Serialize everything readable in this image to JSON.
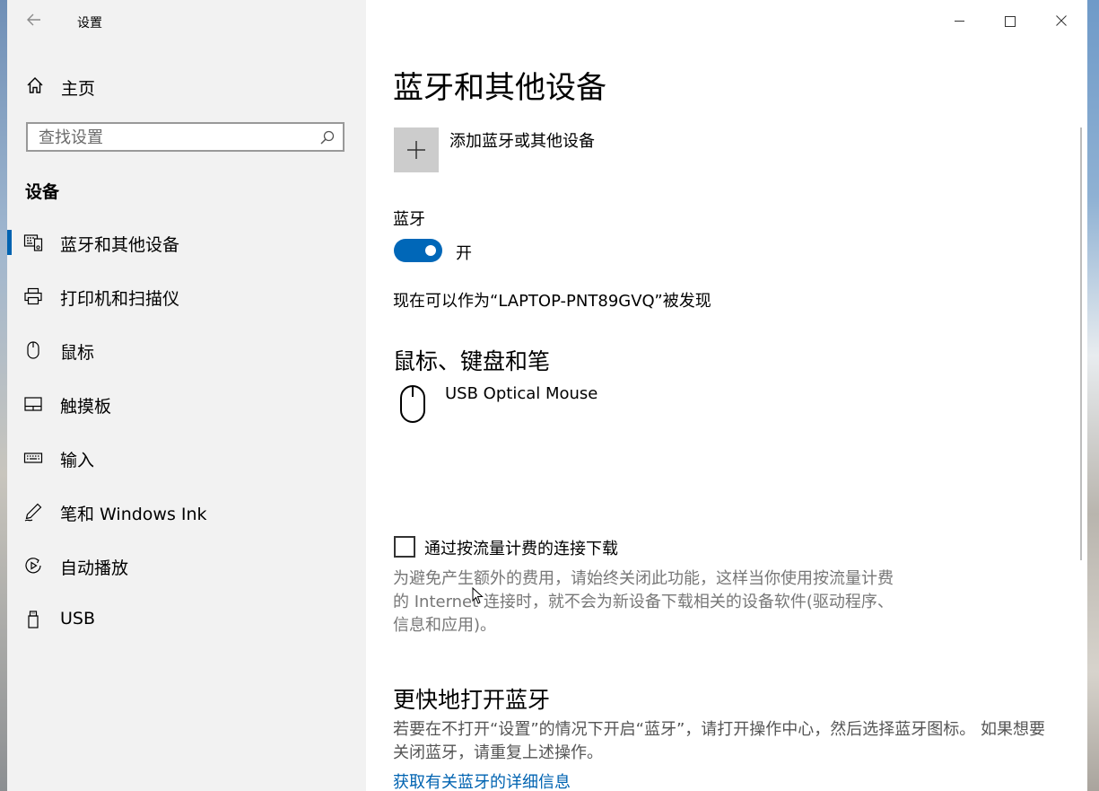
{
  "window": {
    "title": "设置",
    "controls": {
      "minimize": "minimize-icon",
      "maximize": "maximize-icon",
      "close": "close-icon"
    }
  },
  "sidebar": {
    "home_label": "主页",
    "search_placeholder": "查找设置",
    "section_title": "设备",
    "items": [
      {
        "label": "蓝牙和其他设备",
        "icon": "bluetooth-devices-icon",
        "active": true
      },
      {
        "label": "打印机和扫描仪",
        "icon": "printer-icon"
      },
      {
        "label": "鼠标",
        "icon": "mouse-icon"
      },
      {
        "label": "触摸板",
        "icon": "touchpad-icon"
      },
      {
        "label": "输入",
        "icon": "keyboard-icon"
      },
      {
        "label": "笔和 Windows Ink",
        "icon": "pen-icon"
      },
      {
        "label": "自动播放",
        "icon": "autoplay-icon"
      },
      {
        "label": "USB",
        "icon": "usb-icon"
      }
    ]
  },
  "main": {
    "title": "蓝牙和其他设备",
    "add_device_label": "添加蓝牙或其他设备",
    "bluetooth_label": "蓝牙",
    "bluetooth_state": "开",
    "bluetooth_on": true,
    "discoverable_text": "现在可以作为“LAPTOP-PNT89GVQ”被发现",
    "mouse_section_title": "鼠标、键盘和笔",
    "devices": [
      {
        "name": "USB Optical Mouse",
        "icon": "mouse-icon"
      }
    ],
    "metered_checkbox_label": "通过按流量计费的连接下载",
    "metered_checked": false,
    "metered_description": "为避免产生额外的费用，请始终关闭此功能，这样当你使用按流量计费的 Internet 连接时，就不会为新设备下载相关的设备软件(驱动程序、信息和应用)。",
    "quick_section_title": "更快地打开蓝牙",
    "quick_description": "若要在不打开“设置”的情况下开启“蓝牙”，请打开操作中心，然后选择蓝牙图标。 如果想要关闭蓝牙，请重复上述操作。",
    "more_info_link": "获取有关蓝牙的详细信息"
  },
  "colors": {
    "accent": "#0067b8",
    "sidebar_bg": "#f2f2f2",
    "link": "#0063b1"
  }
}
